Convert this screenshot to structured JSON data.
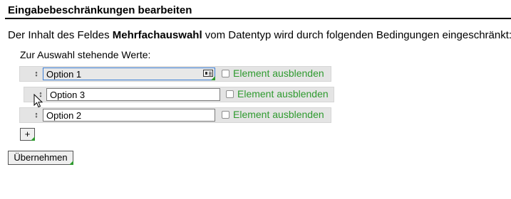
{
  "dialog": {
    "title": "Eingabebeschränkungen bearbeiten",
    "description_prefix": "Der Inhalt des Feldes ",
    "field_name": "Mehrfachauswahl",
    "description_suffix": " vom Datentyp wird durch folgenden Bedingungen eingeschränkt:",
    "values_label": "Zur Auswahl stehende Werte:"
  },
  "options": [
    {
      "value": "Option 1",
      "hide_label": "Element ausblenden",
      "hidden": false,
      "focused": true
    },
    {
      "value": "Option 3",
      "hide_label": "Element ausblenden",
      "hidden": false,
      "focused": false
    },
    {
      "value": "Option 2",
      "hide_label": "Element ausblenden",
      "hidden": false,
      "focused": false
    }
  ],
  "icons": {
    "drag_handle": "up-down-arrow-icon",
    "value_picker": "id-card-icon",
    "cursor": "mouse-pointer-icon"
  },
  "buttons": {
    "add_label": "+",
    "apply_label": "Übernehmen"
  },
  "colors": {
    "accent_green": "#2e9a2e",
    "focus_blue": "#3c7fd6",
    "row_bg": "#e4e4e4"
  }
}
